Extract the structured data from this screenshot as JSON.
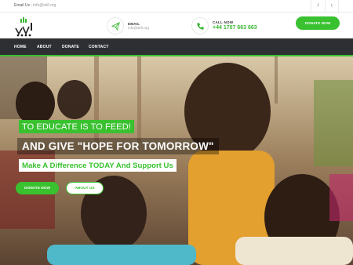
{
  "topbar": {
    "email_label": "Email Us :",
    "email_value": "info@skfi.org",
    "social": {
      "facebook": "f",
      "twitter": "t"
    }
  },
  "header": {
    "email": {
      "label": "EMAIL",
      "value": "info@skfi.org",
      "icon": "paper-plane-icon"
    },
    "phone": {
      "label": "CALL NOW",
      "value": "+44 1707 663 663",
      "icon": "phone-icon"
    },
    "donate_button": "DONATE NOW"
  },
  "nav": {
    "items": [
      {
        "label": "HOME"
      },
      {
        "label": "ABOUT"
      },
      {
        "label": "DONATE"
      },
      {
        "label": "CONTACT"
      }
    ]
  },
  "hero": {
    "line1": "TO EDUCATE IS TO FEED!",
    "line2": "AND GIVE \"HOPE FOR TOMORROW\"",
    "line3": "Make A Difference TODAY And Support Us",
    "donate_button": "DONATE NOW",
    "about_button": "ABOUT US"
  },
  "colors": {
    "accent": "#39c12f",
    "nav_bg": "#2e2f33",
    "text_dark": "#333333"
  }
}
